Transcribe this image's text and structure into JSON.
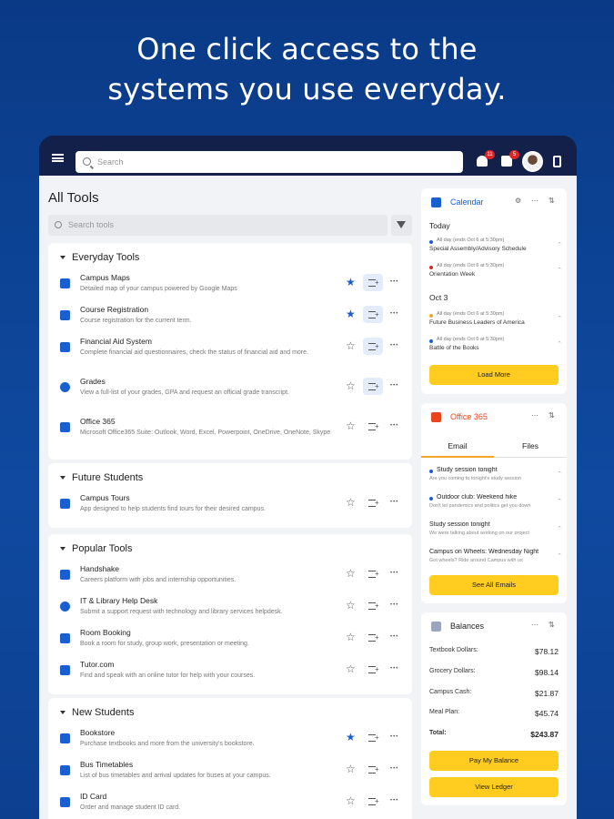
{
  "hero": {
    "line1": "One click access to the",
    "line2": "systems you use everyday."
  },
  "topbar": {
    "search_placeholder": "Search",
    "notifications_count": "11",
    "messages_count": "5"
  },
  "tools": {
    "title": "All Tools",
    "search_placeholder": "Search tools",
    "sections": [
      {
        "title": "Everyday Tools",
        "items": [
          {
            "name": "Campus Maps",
            "desc": "Detailed map of your campus powered by Google Maps",
            "icon": "map-icon",
            "starred": true,
            "added": true
          },
          {
            "name": "Course Registration",
            "desc": "Course registration for the current term.",
            "icon": "monitor-icon",
            "starred": true,
            "added": true
          },
          {
            "name": "Financial Aid System",
            "desc": "Complete financial aid questionnaires, check the status of financial aid and more.",
            "icon": "money-icon",
            "starred": false,
            "added": true
          },
          {
            "name": "Grades",
            "desc": "View a full-list of your grades, GPA and request an official grade transcript.",
            "icon": "check-circle-icon",
            "starred": false,
            "added": true
          },
          {
            "name": "Office 365",
            "desc": "Microsoft Office365 Suite: Outlook, Word, Excel, Powerpoint, OneDrive, OneNote, Skype",
            "icon": "office-icon",
            "starred": false,
            "added": false
          }
        ]
      },
      {
        "title": "Future Students",
        "items": [
          {
            "name": "Campus Tours",
            "desc": "App designed to help students find tours for their desired campus.",
            "icon": "signpost-icon",
            "starred": false,
            "added": false
          }
        ]
      },
      {
        "title": "Popular Tools",
        "items": [
          {
            "name": "Handshake",
            "desc": "Careers platform with jobs and internship opportunities.",
            "icon": "briefcase-icon",
            "starred": false,
            "added": false
          },
          {
            "name": "IT & Library Help Desk",
            "desc": "Submit a support request with technology and library services helpdesk.",
            "icon": "globe-icon",
            "starred": false,
            "added": false
          },
          {
            "name": "Room Booking",
            "desc": "Book a room for study, group work, presentation or meeting.",
            "icon": "room-icon",
            "starred": false,
            "added": false
          },
          {
            "name": "Tutor.com",
            "desc": "Find and speak with an online tutor for help with your courses.",
            "icon": "tutor-icon",
            "starred": false,
            "added": false
          }
        ]
      },
      {
        "title": "New Students",
        "items": [
          {
            "name": "Bookstore",
            "desc": "Purchase textbooks and more from the university's bookstore.",
            "icon": "book-icon",
            "starred": true,
            "added": false
          },
          {
            "name": "Bus Timetables",
            "desc": "List of bus timetables and arrival updates for buses at your campus.",
            "icon": "bus-icon",
            "starred": false,
            "added": false
          },
          {
            "name": "ID Card",
            "desc": "Order and manage student ID card.",
            "icon": "id-card-icon",
            "starred": false,
            "added": false
          }
        ]
      }
    ]
  },
  "calendar": {
    "title": "Calendar",
    "today_label": "Today",
    "oct3_label": "Oct 3",
    "events": [
      {
        "meta": "All day (ends Oct 6 at 5:30pm)",
        "title": "Special Assembly/Advisory Schedule",
        "color": "#1a5fd0"
      },
      {
        "meta": "All day (ends Oct 6 at 5:30pm)",
        "title": "Orientation Week",
        "color": "#e02424"
      },
      {
        "meta": "All day (ends Oct 6 at 5:30pm)",
        "title": "Future Business Leaders of America",
        "color": "#f5a623"
      },
      {
        "meta": "All day (ends Oct 6 at 5:30pm)",
        "title": "Battle of the Books",
        "color": "#1a5fd0"
      }
    ],
    "load_more": "Load More"
  },
  "office": {
    "title": "Office 365",
    "tab_email": "Email",
    "tab_files": "Files",
    "emails": [
      {
        "subject": "Study session tonight",
        "preview": "Are you coming to tonight's study session",
        "unread": true
      },
      {
        "subject": "Outdoor club: Weekend hike",
        "preview": "Don't let pandemics and politics get you down",
        "unread": true
      },
      {
        "subject": "Study session tonight",
        "preview": "We were talking about working on our project",
        "unread": false
      },
      {
        "subject": "Campus on Wheels: Wednesday Night",
        "preview": "Got wheels? Ride around Campus with us",
        "unread": false
      }
    ],
    "see_all": "See All Emails"
  },
  "balances": {
    "title": "Balances",
    "rows": [
      {
        "label": "Textbook Dollars:",
        "value": "$78.12"
      },
      {
        "label": "Grocery Dollars:",
        "value": "$98.14"
      },
      {
        "label": "Campus Cash:",
        "value": "$21.87"
      },
      {
        "label": "Meal Plan:",
        "value": "$45.74"
      }
    ],
    "total_label": "Total:",
    "total_value": "$243.87",
    "pay": "Pay My Balance",
    "ledger": "View Ledger"
  },
  "colors": {
    "accent": "#1a5fd0",
    "button": "#ffcc1f",
    "office": "#e8451e"
  }
}
